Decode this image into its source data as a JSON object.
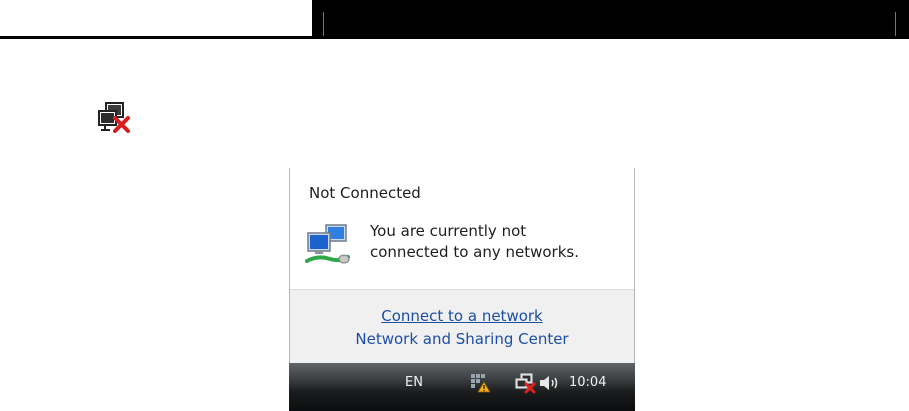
{
  "popup": {
    "title": "Not Connected",
    "message_line1": "You are currently not",
    "message_line2": "connected to any networks.",
    "connect_link": "Connect to a network",
    "sharing_link": "Network and Sharing Center"
  },
  "taskbar": {
    "language": "EN",
    "clock": "10:04"
  },
  "icons": {
    "standalone": "network-disconnected-icon",
    "popup": "network-computers-icon",
    "tray": [
      "windows-update-icon",
      "network-disconnected-icon",
      "speaker-icon"
    ]
  },
  "colors": {
    "link": "#1d4ea5",
    "error_x": "#e02020",
    "taskbar": "#1a1c1d"
  }
}
